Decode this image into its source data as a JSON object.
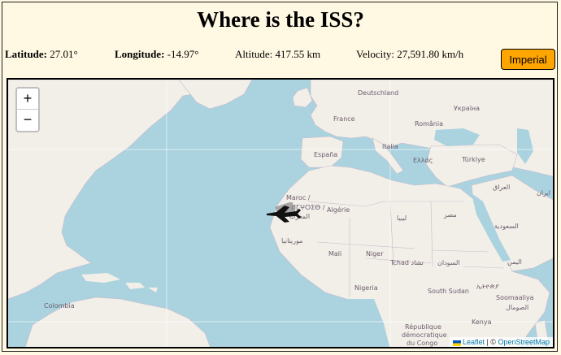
{
  "title": "Where is the ISS?",
  "stats": {
    "latitude_label": "Latitude:",
    "latitude_value": "27.01°",
    "longitude_label": "Longitude:",
    "longitude_value": "-14.97°",
    "altitude_label": "Altitude:",
    "altitude_value": "417.55 km",
    "velocity_label": "Velocity:",
    "velocity_value": "27,591.80 km/h"
  },
  "units_button": "Imperial",
  "map": {
    "zoom_in": "+",
    "zoom_out": "−",
    "labels": {
      "deutschland": "Deutschland",
      "ukraina": "Україна",
      "france": "France",
      "romania": "România",
      "espana": "España",
      "italia": "Italia",
      "ellas": "Ελλάς",
      "turkiye": "Türkiye",
      "iraq": "العراق",
      "iran": "ایران",
      "maroc": "Maroc /",
      "maroc2": "ⵍⵎⵖⵔⵉⴱ /",
      "maroc3": "المغرب",
      "algerie": "Algérie",
      "libya": "ليبيا",
      "misr": "مصر",
      "saudia": "السعودية",
      "mauritania": "موريتانيا",
      "mali": "Mali",
      "niger": "Niger",
      "tchad": "Tchad تشاد",
      "sudan": "السودان",
      "yemen": "اليمن",
      "ethiopia": "ኢትዮጵያ",
      "nigeria": "Nigeria",
      "south_sudan": "South Sudan",
      "somalia": "Soomaaliya",
      "somalia2": "الصومال",
      "colombia": "Colombia",
      "kenya": "Kenya",
      "rdc1": "République",
      "rdc2": "démocratique",
      "rdc3": "du Congo"
    },
    "attribution_leaflet": "Leaflet",
    "attribution_sep": " | © ",
    "attribution_osm": "OpenStreetMap"
  },
  "colors": {
    "background": "#fff8e2",
    "button": "#ffa500",
    "water": "#aad3df",
    "land": "#f2efe9"
  },
  "icons": {
    "iss_marker": "satellite-icon"
  }
}
